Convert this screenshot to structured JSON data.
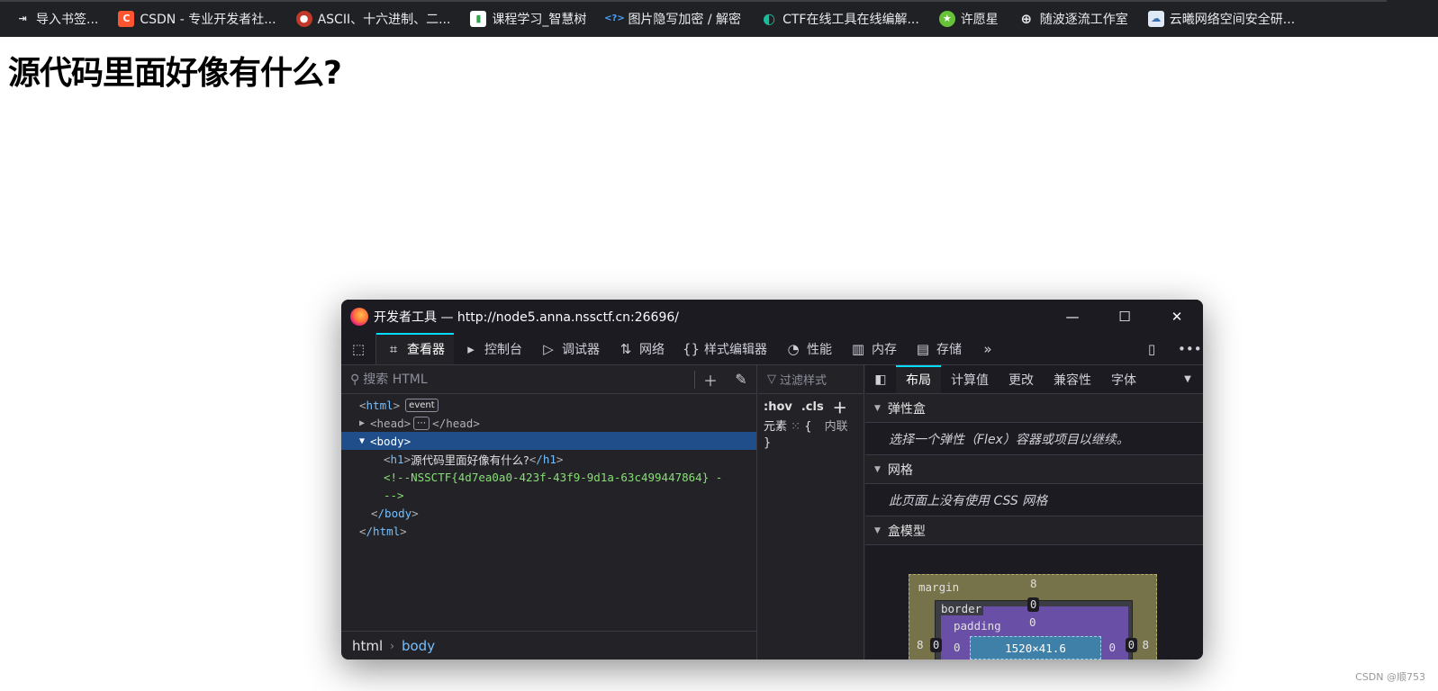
{
  "bookmarks": [
    {
      "icon": "import-icon",
      "label": "导入书签..."
    },
    {
      "icon": "csdn-logo-icon",
      "label": "CSDN - 专业开发者社..."
    },
    {
      "icon": "ascii-site-icon",
      "label": "ASCII、十六进制、二..."
    },
    {
      "icon": "course-icon",
      "label": "课程学习_智慧树"
    },
    {
      "icon": "code-icon",
      "label": "图片隐写加密 / 解密"
    },
    {
      "icon": "ctf-tool-icon",
      "label": "CTF在线工具在线编解..."
    },
    {
      "icon": "star-icon",
      "label": "许愿星"
    },
    {
      "icon": "globe-icon",
      "label": "随波逐流工作室"
    },
    {
      "icon": "cloud-icon",
      "label": "云曦网络空间安全研..."
    }
  ],
  "page": {
    "heading": "源代码里面好像有什么?",
    "watermark": "CSDN @顺753"
  },
  "devtools": {
    "title": "开发者工具 — http://node5.anna.nssctf.cn:26696/",
    "win_minimize": "—",
    "win_maximize": "☐",
    "win_close": "✕",
    "tools": [
      {
        "icon": "inspector-icon",
        "label": "查看器",
        "selected": true
      },
      {
        "icon": "console-icon",
        "label": "控制台"
      },
      {
        "icon": "debugger-icon",
        "label": "调试器"
      },
      {
        "icon": "network-icon",
        "label": "网络"
      },
      {
        "icon": "style-editor-icon",
        "label": "样式编辑器"
      },
      {
        "icon": "performance-icon",
        "label": "性能"
      },
      {
        "icon": "memory-icon",
        "label": "内存"
      },
      {
        "icon": "storage-icon",
        "label": "存储"
      }
    ],
    "search_placeholder": "搜索 HTML",
    "tree": {
      "html_open": "html",
      "event_badge": "event",
      "head_open": "head",
      "head_close": "/head",
      "body_open": "body",
      "h1_open": "h1",
      "h1_text": "源代码里面好像有什么?",
      "h1_close": "/h1",
      "comment_line1": "<!--NSSCTF{4d7ea0a0-423f-43f9-9d1a-63c499447864} -",
      "comment_line2": "-->",
      "body_close": "/body",
      "html_close": "/html"
    },
    "breadcrumbs": {
      "first": "html",
      "second": "body"
    },
    "rules": {
      "filter_placeholder": "过滤样式",
      "hov": ":hov",
      "cls": ".cls",
      "element_label": "元素",
      "brace_open": "{",
      "inline_label": "内联",
      "brace_close": "}"
    },
    "side_tabs": [
      {
        "label": "布局",
        "selected": true
      },
      {
        "label": "计算值"
      },
      {
        "label": "更改"
      },
      {
        "label": "兼容性"
      },
      {
        "label": "字体"
      }
    ],
    "flexbox": {
      "title": "弹性盒",
      "message": "选择一个弹性（Flex）容器或项目以继续。"
    },
    "grid": {
      "title": "网格",
      "message": "此页面上没有使用 CSS 网格"
    },
    "boxmodel": {
      "title": "盒模型",
      "margin_label": "margin",
      "border_label": "border",
      "padding_label": "padding",
      "content_size": "1520×41.6",
      "margin_top": "8",
      "margin_left": "8",
      "margin_right": "8",
      "border_top": "0",
      "border_left": "0",
      "border_right": "0",
      "padding_top": "0",
      "padding_left": "0",
      "padding_right": "0"
    }
  }
}
